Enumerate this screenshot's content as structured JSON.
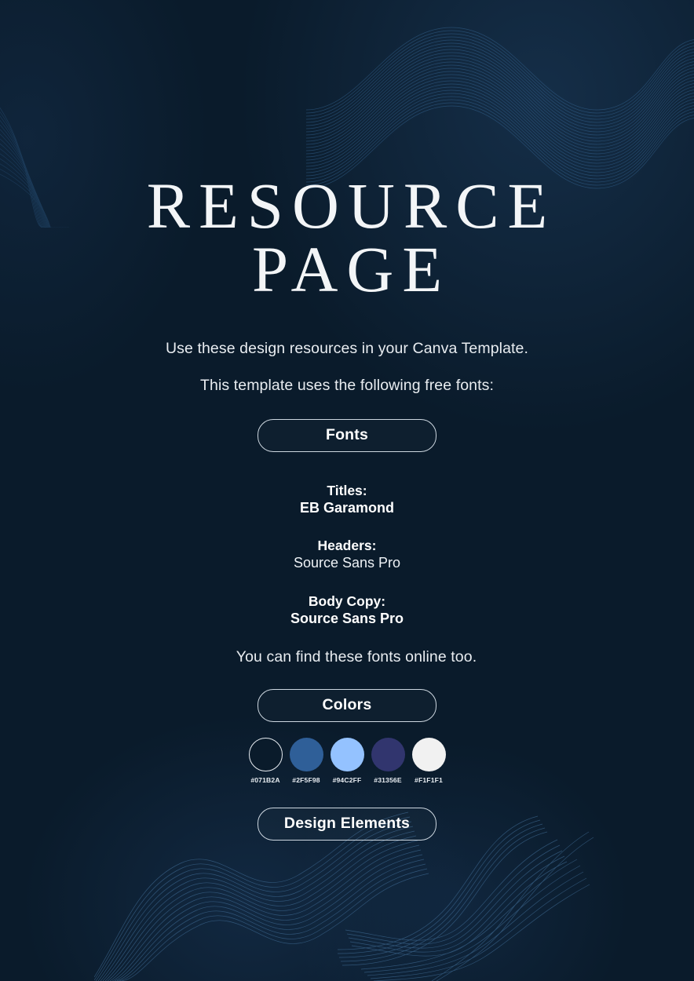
{
  "page": {
    "background_color": "#0A1B2B",
    "title_line1": "RESOURCE",
    "title_line2": "PAGE"
  },
  "intro": {
    "line1": "Use these design resources in your Canva Template.",
    "line2": "This template uses the following free fonts:"
  },
  "sections": {
    "fonts_label": "Fonts",
    "colors_label": "Colors",
    "design_elements_label": "Design Elements"
  },
  "fonts": {
    "titles_label": "Titles:",
    "titles_value": "EB Garamond",
    "headers_label": "Headers:",
    "headers_value": "Source Sans Pro",
    "body_label": "Body Copy:",
    "body_value": "Source Sans Pro",
    "note": "You can find these fonts online too."
  },
  "colors": {
    "swatches": [
      {
        "hex": "#071B2A",
        "label": "#071B2A",
        "outlined": true
      },
      {
        "hex": "#2F5F98",
        "label": "#2F5F98",
        "outlined": false
      },
      {
        "hex": "#94C2FF",
        "label": "#94C2FF",
        "outlined": false
      },
      {
        "hex": "#31356E",
        "label": "#31356E",
        "outlined": false
      },
      {
        "hex": "#F1F1F1",
        "label": "#F1F1F1",
        "outlined": false
      }
    ]
  }
}
